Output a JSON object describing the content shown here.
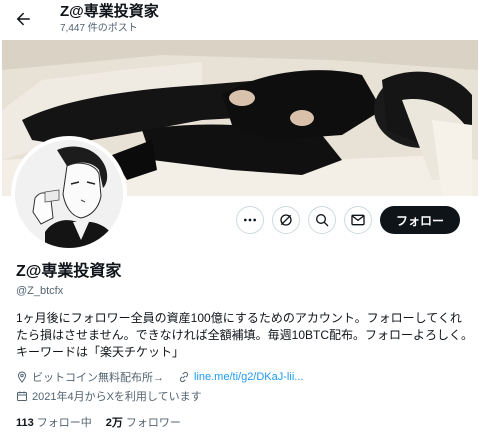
{
  "header": {
    "title": "Z@専業投資家",
    "post_count": "7,447 件のポスト"
  },
  "profile": {
    "display_name": "Z@専業投資家",
    "handle": "@Z_btcfx",
    "bio_lines": [
      "1ヶ月後にフォロワー全員の資産100億にするためのアカウント。フォローしてくれ",
      "たら損はさせません。できなければ全額補填。毎週10BTC配布。フォローよろしく。",
      "キーワードは「楽天チケット」"
    ],
    "location": "ビットコイン無料配布所→",
    "link": "line.me/ti/g2/DKaJ-lii...",
    "joined": "2021年4月からXを利用しています",
    "following_count": "113",
    "following_label": "フォロー中",
    "followers_count": "2万",
    "followers_label": "フォロワー"
  },
  "actions": {
    "follow_label": "フォロー"
  },
  "icons": {
    "back": "arrow-left-icon",
    "more": "more-icon",
    "repost_notify": "no-repost-icon",
    "search": "search-icon",
    "message": "mail-icon",
    "location": "location-pin-icon",
    "link": "link-icon",
    "calendar": "calendar-icon"
  },
  "colors": {
    "text": "#0f1419",
    "secondary": "#536471",
    "link": "#1d9bf0",
    "follow_bg": "#0f1419"
  }
}
